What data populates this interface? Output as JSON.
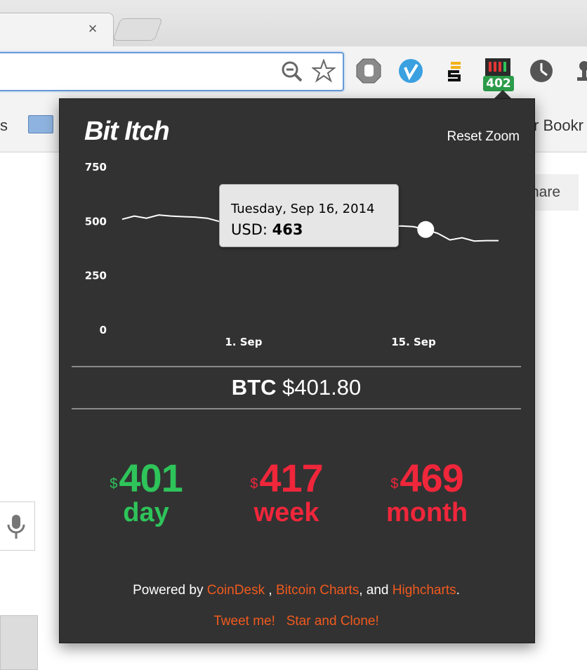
{
  "browser": {
    "tab_close": "×",
    "bookmark_left_fragment": "s",
    "bookmark_right_fragment": "r Bookr",
    "badge_count": "402",
    "share_fragment": "hare"
  },
  "popup": {
    "title": "Bit Itch",
    "reset_zoom": "Reset Zoom",
    "tooltip": {
      "date": "Tuesday, Sep 16, 2014",
      "label": "USD:",
      "value": "463"
    },
    "price": {
      "symbol": "BTC",
      "dollar": "$",
      "value": "401.80"
    },
    "stats": [
      {
        "currency": "$",
        "value": "401",
        "label": "day",
        "color": "#2ec45a"
      },
      {
        "currency": "$",
        "value": "417",
        "label": "week",
        "color": "#f0263b"
      },
      {
        "currency": "$",
        "value": "469",
        "label": "month",
        "color": "#f0263b"
      }
    ],
    "footer": {
      "powered_by": "Powered by",
      "link_coindesk": "CoinDesk",
      "sep1": ",",
      "link_bitcoincharts": "Bitcoin Charts",
      "sep2": ", and",
      "link_highcharts": "Highcharts",
      "end": ".",
      "tweet": "Tweet me!",
      "star": "Star and Clone!"
    },
    "accent_link_color": "#f05a1e"
  },
  "chart_data": {
    "type": "line",
    "title": "",
    "xlabel": "",
    "ylabel": "",
    "ylim": [
      0,
      750
    ],
    "yticks": [
      "0",
      "250",
      "500",
      "750"
    ],
    "xticks": [
      {
        "label": "1. Sep",
        "day": 1
      },
      {
        "label": "15. Sep",
        "day": 15
      }
    ],
    "x_days": [
      -9,
      -8,
      -7,
      -6,
      -5,
      -4,
      -3,
      -2,
      -1,
      0,
      1,
      2,
      3,
      4,
      5,
      6,
      7,
      8,
      9,
      10,
      11,
      12,
      13,
      14,
      15,
      16,
      17,
      18,
      19,
      20,
      21,
      22
    ],
    "series": [
      {
        "values": [
          510,
          525,
          515,
          530,
          525,
          522,
          520,
          515,
          500,
          480,
          478,
          482,
          480,
          482,
          476,
          485,
          480,
          478,
          476,
          480,
          482,
          478,
          476,
          479,
          476,
          463,
          445,
          415,
          425,
          410,
          412,
          412
        ]
      }
    ],
    "highlight": {
      "day": 16,
      "value": 463
    },
    "grid": false
  }
}
